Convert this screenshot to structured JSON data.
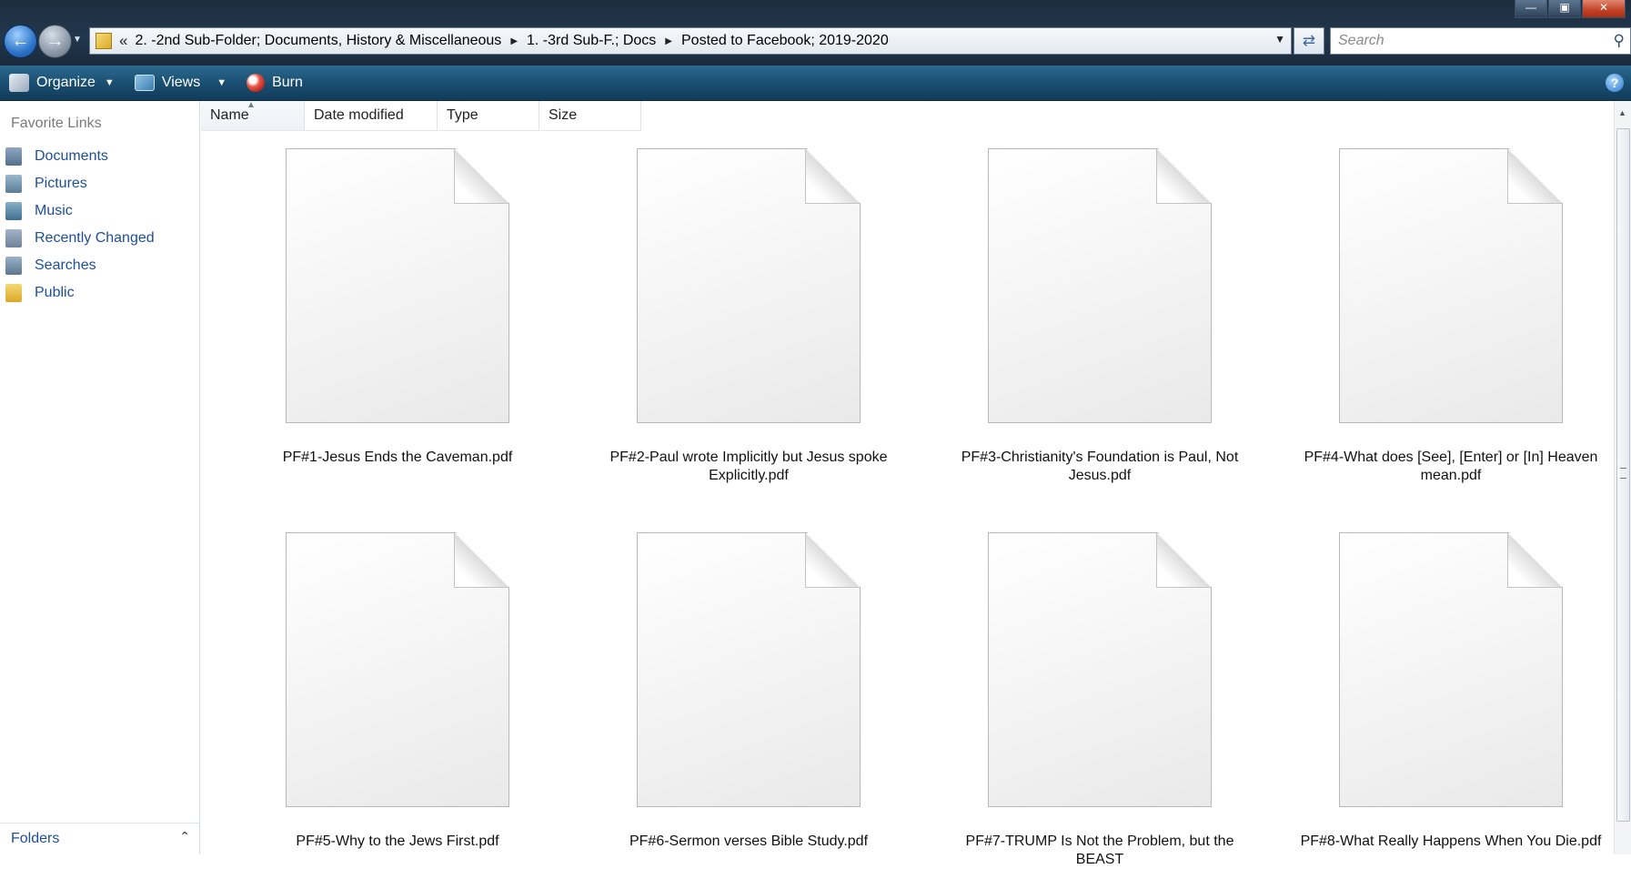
{
  "window": {
    "minimize_label": "—",
    "maximize_label": "▣",
    "close_label": "✕"
  },
  "address": {
    "prefix": "«",
    "crumbs": [
      "2. -2nd Sub-Folder; Documents, History & Miscellaneous",
      "1. -3rd Sub-F.; Docs",
      "Posted to Facebook; 2019-2020"
    ]
  },
  "search": {
    "placeholder": "Search"
  },
  "toolbar": {
    "organize": "Organize",
    "views": "Views",
    "burn": "Burn",
    "help": "?"
  },
  "nav": {
    "heading": "Favorite Links",
    "items": [
      "Documents",
      "Pictures",
      "Music",
      "Recently Changed",
      "Searches",
      "Public"
    ],
    "folders_label": "Folders"
  },
  "columns": [
    "Name",
    "Date modified",
    "Type",
    "Size"
  ],
  "files": [
    "PF#1-Jesus Ends the Caveman.pdf",
    "PF#2-Paul wrote Implicitly but  Jesus spoke Explicitly.pdf",
    "PF#3-Christianity's Foundation is  Paul, Not Jesus.pdf",
    "PF#4-What does [See], [Enter] or  [In] Heaven mean.pdf",
    "PF#5-Why to the Jews First.pdf",
    "PF#6-Sermon verses Bible Study.pdf",
    "PF#7-TRUMP Is Not the Problem, but  the BEAST",
    "PF#8-What Really Happens When You  Die.pdf"
  ]
}
